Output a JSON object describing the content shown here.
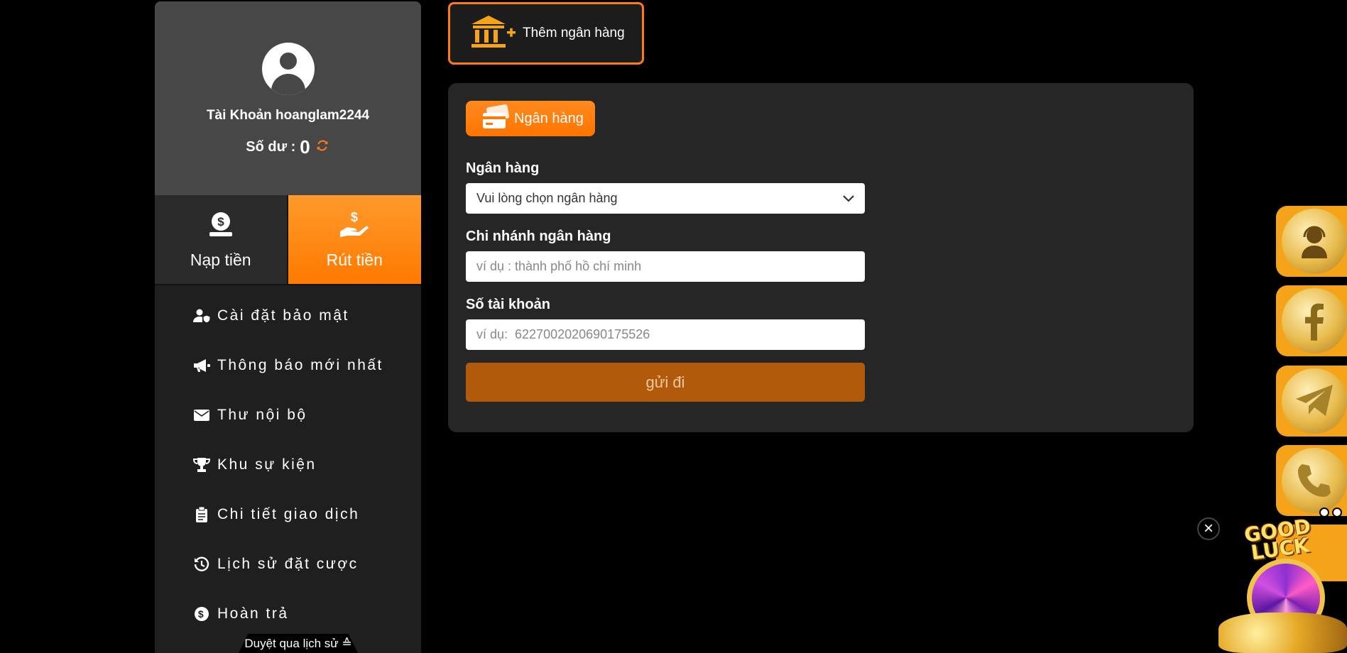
{
  "sidebar": {
    "account_label": "Tài Khoản hoanglam2244",
    "balance_label": "Số dư :",
    "balance_value": "0",
    "actions": {
      "deposit": "Nạp tiền",
      "withdraw": "Rút tiền"
    },
    "menu": [
      {
        "label": "Cài đặt bảo mật",
        "icon": "user-shield-icon"
      },
      {
        "label": "Thông báo mới nhất",
        "icon": "megaphone-icon"
      },
      {
        "label": "Thư nội bộ",
        "icon": "envelope-icon"
      },
      {
        "label": "Khu sự kiện",
        "icon": "trophy-icon"
      },
      {
        "label": "Chi tiết giao dịch",
        "icon": "clipboard-icon"
      },
      {
        "label": "Lịch sử đặt cược",
        "icon": "history-icon"
      },
      {
        "label": "Hoàn trả",
        "icon": "dollar-circle-icon"
      }
    ],
    "history_tab": "Duyệt qua lịch sử ≙"
  },
  "add_bank": {
    "label": "Thêm ngân hàng",
    "icon": "bank-plus-icon"
  },
  "form": {
    "tab_label": "Ngân hàng",
    "tab_icon": "credit-card-icon",
    "bank_label": "Ngân hàng",
    "bank_select_value": "Vui lòng chọn ngân hàng",
    "branch_label": "Chi nhánh ngân hàng",
    "branch_placeholder": "ví dụ : thành phố hồ chí minh",
    "account_label": "Số tài khoản",
    "account_placeholder": "ví dụ:  6227002020690175526",
    "submit_label": "gửi đi"
  },
  "floating": {
    "buttons": [
      "support-agent-icon",
      "facebook-icon",
      "telegram-icon",
      "phone-icon"
    ],
    "promo_title": "GOOD LUCK",
    "close_icon": "×"
  },
  "colors": {
    "accent": "#ff7a1a",
    "submit": "#b15a0c",
    "panel": "#262626",
    "sidebar": "#1f1f1f"
  }
}
